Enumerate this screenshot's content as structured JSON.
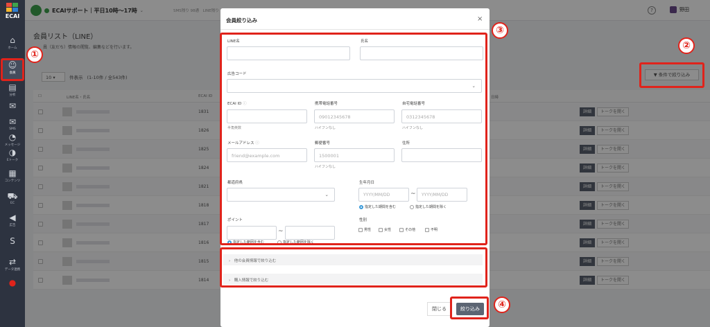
{
  "sidebar": {
    "logo_text": "ECAI",
    "items": [
      {
        "label": "ホーム",
        "icon": "home-icon",
        "glyph": "⌂"
      },
      {
        "label": "会員",
        "icon": "members-icon",
        "glyph": "☺"
      },
      {
        "label": "分析",
        "icon": "analytics-icon",
        "glyph": "▤"
      },
      {
        "label": "",
        "icon": "chat-icon",
        "glyph": "✉"
      },
      {
        "label": "SMS",
        "icon": "sms-icon",
        "glyph": "✉"
      },
      {
        "label": "メッセージ",
        "icon": "message-icon",
        "glyph": "◔"
      },
      {
        "label": "Eトーク",
        "icon": "talk-icon",
        "glyph": "◑"
      },
      {
        "label": "コンテンツ",
        "icon": "content-icon",
        "glyph": "▦"
      },
      {
        "label": "EC",
        "icon": "cart-icon",
        "glyph": "⛟"
      },
      {
        "label": "広告",
        "icon": "megaphone-icon",
        "glyph": "◀"
      },
      {
        "label": "",
        "icon": "shopify-icon",
        "glyph": "S"
      },
      {
        "label": "データ連携",
        "icon": "data-link-icon",
        "glyph": "⇄"
      },
      {
        "label": "",
        "icon": "robot-icon",
        "glyph": "●"
      }
    ]
  },
  "topbar": {
    "title": "ECAIサポート｜平日10時～17時",
    "quota": "SMS残り 98通　LINE残り 1814通",
    "help": "?",
    "user": "野田"
  },
  "page": {
    "title": "会員リスト（LINE）",
    "subtitle": "員（友だち）情報の閲覧、編集などを行います。",
    "per_page": "10",
    "per_page_label": "件表示",
    "range": "(1-10件 / 全543件)",
    "filter_button": "▼ 条件で絞り込み"
  },
  "table": {
    "headers": [
      "LINE名・氏名",
      "ECAI ID",
      "日時"
    ],
    "rows": [
      {
        "id": "1831"
      },
      {
        "id": "1826"
      },
      {
        "id": "1825"
      },
      {
        "id": "1824"
      },
      {
        "id": "1821"
      },
      {
        "id": "1818"
      },
      {
        "id": "1817"
      },
      {
        "id": "1816"
      },
      {
        "id": "1815"
      },
      {
        "id": "1814"
      }
    ],
    "detail_label": "詳細",
    "talk_label": "トークを開く"
  },
  "modal": {
    "title": "会員絞り込み",
    "close": "×",
    "line_name": "LINE名",
    "full_name": "氏名",
    "ad_code": "広告コード",
    "ecai_id": "ECAI ID",
    "ecai_hint": "半角英数",
    "mobile": "携帯電話番号",
    "mobile_ph": "09012345678",
    "mobile_hint": "ハイフンなし",
    "home_phone": "自宅電話番号",
    "home_ph": "0312345678",
    "home_hint": "ハイフンなし",
    "email": "メールアドレス",
    "email_ph": "friend@example.com",
    "postal": "郵便番号",
    "postal_ph": "1500001",
    "postal_hint": "ハイフンなし",
    "address": "住所",
    "prefecture": "都道府県",
    "birthday": "生年月日",
    "date_ph": "YYYY/MM/DD",
    "tilde": "~",
    "include_range": "指定した期間を含む",
    "exclude_range": "指定した期間を除く",
    "points": "ポイント",
    "include_range2": "指定した範囲を含む",
    "exclude_range2": "指定した範囲を除く",
    "gender": "性別",
    "genders": [
      "男性",
      "女性",
      "その他",
      "不明"
    ],
    "acc_other": "›　他の会員情報で絞り込む",
    "acc_purchase": "›　購入情報で絞り込む",
    "btn_close": "閉じる",
    "btn_apply": "絞り込み"
  },
  "annotations": [
    "①",
    "②",
    "③",
    "④"
  ]
}
